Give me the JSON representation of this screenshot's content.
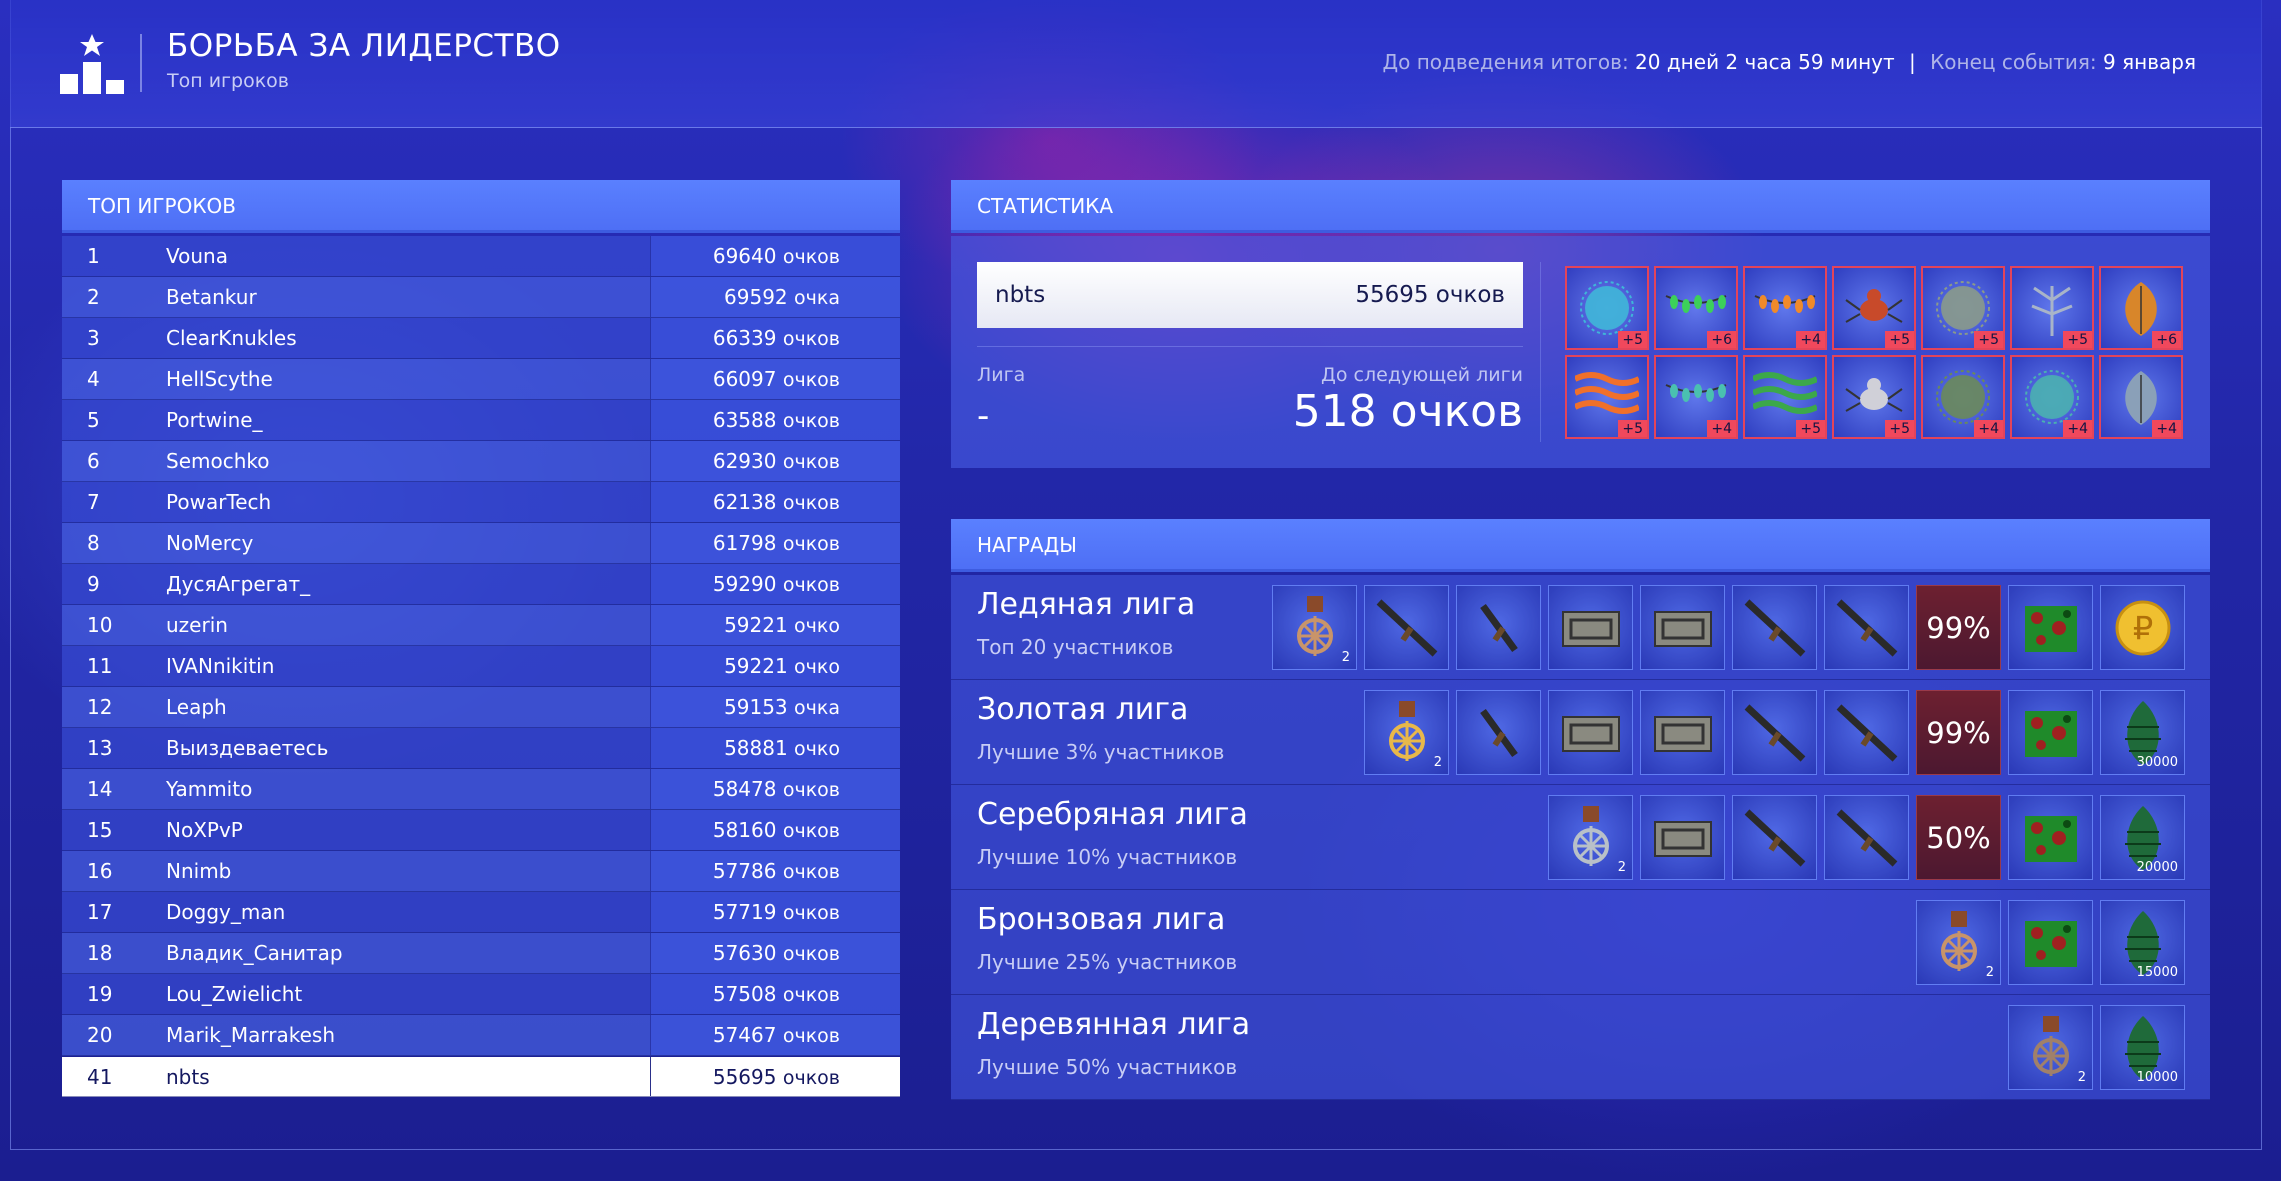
{
  "header": {
    "title": "БОРЬБА ЗА ЛИДЕРСТВО",
    "subtitle": "Топ игроков",
    "timer_label": "До подведения итогов:",
    "timer_value": "20 дней 2 часа 59 минут",
    "separator": "|",
    "end_label": "Конец события:",
    "end_value": "9 января"
  },
  "leaderboard": {
    "title": "ТОП ИГРОКОВ",
    "rows": [
      {
        "rank": "1",
        "name": "Vouna",
        "score": "69640",
        "unit": "очков"
      },
      {
        "rank": "2",
        "name": "Betankur",
        "score": "69592",
        "unit": "очка"
      },
      {
        "rank": "3",
        "name": "ClearKnukles",
        "score": "66339",
        "unit": "очков"
      },
      {
        "rank": "4",
        "name": "HellScythe",
        "score": "66097",
        "unit": "очков"
      },
      {
        "rank": "5",
        "name": "Portwine_",
        "score": "63588",
        "unit": "очков"
      },
      {
        "rank": "6",
        "name": "Semochko",
        "score": "62930",
        "unit": "очков"
      },
      {
        "rank": "7",
        "name": "PowarTech",
        "score": "62138",
        "unit": "очков"
      },
      {
        "rank": "8",
        "name": "NoMercy",
        "score": "61798",
        "unit": "очков"
      },
      {
        "rank": "9",
        "name": "ДусяАгрегат_",
        "score": "59290",
        "unit": "очков"
      },
      {
        "rank": "10",
        "name": "uzerin",
        "score": "59221",
        "unit": "очко"
      },
      {
        "rank": "11",
        "name": "IVANnikitin",
        "score": "59221",
        "unit": "очко"
      },
      {
        "rank": "12",
        "name": "Leaph",
        "score": "59153",
        "unit": "очка"
      },
      {
        "rank": "13",
        "name": "Выиздеваетесь",
        "score": "58881",
        "unit": "очко"
      },
      {
        "rank": "14",
        "name": "Yammito",
        "score": "58478",
        "unit": "очков"
      },
      {
        "rank": "15",
        "name": "NoXPvP",
        "score": "58160",
        "unit": "очков"
      },
      {
        "rank": "16",
        "name": "Nnimb",
        "score": "57786",
        "unit": "очков"
      },
      {
        "rank": "17",
        "name": "Doggy_man",
        "score": "57719",
        "unit": "очков"
      },
      {
        "rank": "18",
        "name": "Владик_Санитар",
        "score": "57630",
        "unit": "очков"
      },
      {
        "rank": "19",
        "name": "Lou_Zwielicht",
        "score": "57508",
        "unit": "очков"
      },
      {
        "rank": "20",
        "name": "Marik_Marrakesh",
        "score": "57467",
        "unit": "очков"
      }
    ],
    "me": {
      "rank": "41",
      "name": "nbts",
      "score": "55695",
      "unit": "очков"
    }
  },
  "stats": {
    "title": "СТАТИСТИКА",
    "player_name": "nbts",
    "player_score": "55695 очков",
    "league_label": "Лига",
    "league_value": "-",
    "next_label": "До следующей лиги",
    "next_value": "518 очков",
    "items": [
      {
        "icon": "blue-virus-icon",
        "badge": "+5",
        "color": "#3fb6d8"
      },
      {
        "icon": "green-lights-garland-icon",
        "badge": "+6",
        "color": "#3cd05a"
      },
      {
        "icon": "orange-lights-garland-icon",
        "badge": "+4",
        "color": "#f08a2a"
      },
      {
        "icon": "spider-creature-icon",
        "badge": "+5",
        "color": "#c84a2a"
      },
      {
        "icon": "gray-moss-ball-icon",
        "badge": "+5",
        "color": "#8a9a8a"
      },
      {
        "icon": "frost-branch-icon",
        "badge": "+5",
        "color": "#a8b4c8"
      },
      {
        "icon": "orange-leaf-pod-icon",
        "badge": "+6",
        "color": "#d8862a"
      },
      {
        "icon": "orange-tinsel-icon",
        "badge": "+5",
        "color": "#f0702a"
      },
      {
        "icon": "blue-lights-garland-icon",
        "badge": "+4",
        "color": "#4ac0b0"
      },
      {
        "icon": "green-vines-icon",
        "badge": "+5",
        "color": "#3ca84a"
      },
      {
        "icon": "white-moth-icon",
        "badge": "+5",
        "color": "#d0d0d8"
      },
      {
        "icon": "purple-orb-icon",
        "badge": "+4",
        "color": "#6a8a5a"
      },
      {
        "icon": "teal-coral-icon",
        "badge": "+4",
        "color": "#4ab0b0"
      },
      {
        "icon": "ghost-leaf-icon",
        "badge": "+4",
        "color": "#8aa0b8"
      }
    ]
  },
  "rewards": {
    "title": "НАГРАДЫ",
    "leagues": [
      {
        "name": "Ледяная лига",
        "desc": "Топ 20 участников",
        "slots": [
          {
            "icon": "snowflake-medal-icon",
            "count": "2"
          },
          {
            "icon": "sniper-rifle-icon",
            "count": ""
          },
          {
            "icon": "pistol-icon",
            "count": ""
          },
          {
            "icon": "ammo-case-icon",
            "count": ""
          },
          {
            "icon": "ammo-case-icon",
            "count": ""
          },
          {
            "icon": "long-rifle-icon",
            "count": ""
          },
          {
            "icon": "assault-rifle-icon",
            "count": ""
          },
          {
            "icon": "percent-boost",
            "pct": "99%"
          },
          {
            "icon": "camo-crate-icon",
            "count": ""
          },
          {
            "icon": "ruble-coin-icon",
            "count": ""
          }
        ]
      },
      {
        "name": "Золотая лига",
        "desc": "Лучшие 3% участников",
        "slots": [
          {
            "icon": "gold-star-medal-icon",
            "count": "2"
          },
          {
            "icon": "pistol-icon",
            "count": ""
          },
          {
            "icon": "ammo-case-icon",
            "count": ""
          },
          {
            "icon": "ammo-case-icon",
            "count": ""
          },
          {
            "icon": "long-rifle-icon",
            "count": ""
          },
          {
            "icon": "assault-rifle-icon",
            "count": ""
          },
          {
            "icon": "percent-boost",
            "pct": "99%"
          },
          {
            "icon": "camo-crate-icon",
            "count": ""
          },
          {
            "icon": "pine-cone-icon",
            "count": "30000"
          }
        ]
      },
      {
        "name": "Серебряная лига",
        "desc": "Лучшие 10% участников",
        "slots": [
          {
            "icon": "silver-medal-icon",
            "count": "2"
          },
          {
            "icon": "ammo-case-icon",
            "count": ""
          },
          {
            "icon": "long-rifle-icon",
            "count": ""
          },
          {
            "icon": "assault-rifle-icon",
            "count": ""
          },
          {
            "icon": "percent-boost",
            "pct": "50%"
          },
          {
            "icon": "camo-crate-icon",
            "count": ""
          },
          {
            "icon": "pine-cone-icon",
            "count": "20000"
          }
        ]
      },
      {
        "name": "Бронзовая лига",
        "desc": "Лучшие 25% участников",
        "slots": [
          {
            "icon": "bronze-medal-icon",
            "count": "2"
          },
          {
            "icon": "camo-crate-icon",
            "count": ""
          },
          {
            "icon": "pine-cone-icon",
            "count": "15000"
          }
        ]
      },
      {
        "name": "Деревянная лига",
        "desc": "Лучшие 50% участников",
        "slots": [
          {
            "icon": "wood-medal-icon",
            "count": "2"
          },
          {
            "icon": "pine-cone-icon",
            "count": "10000"
          }
        ]
      }
    ]
  },
  "colors": {
    "panel_header": "#5a80ff",
    "item_border": "#e3445a",
    "badge": "#f0485c"
  }
}
